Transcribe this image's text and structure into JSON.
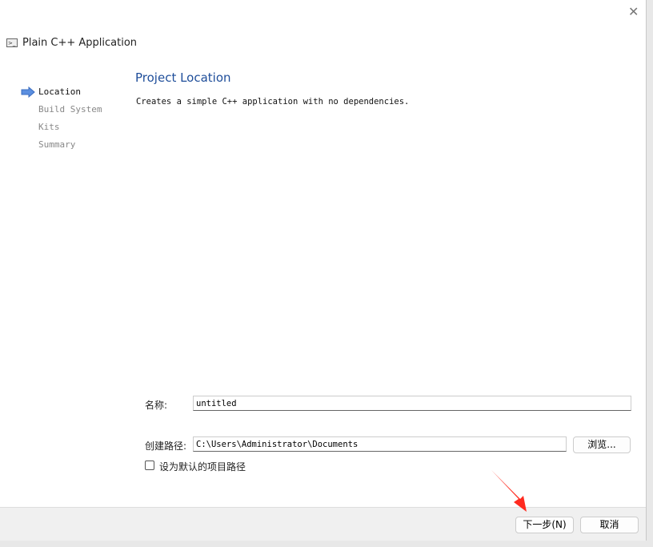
{
  "window": {
    "title": "Plain C++ Application",
    "close_icon": "close-icon"
  },
  "sidebar": {
    "items": [
      {
        "label": "Location",
        "active": true
      },
      {
        "label": "Build System"
      },
      {
        "label": "Kits"
      },
      {
        "label": "Summary"
      }
    ]
  },
  "main": {
    "heading": "Project Location",
    "description": "Creates a simple C++ application with no dependencies."
  },
  "form": {
    "name_label": "名称:",
    "name_value": "untitled",
    "path_label": "创建路径:",
    "path_value": "C:\\Users\\Administrator\\Documents",
    "browse_label": "浏览...",
    "default_checkbox_label": "设为默认的项目路径",
    "default_checked": false
  },
  "footer": {
    "next_label": "下一步(N)",
    "cancel_label": "取消"
  },
  "colors": {
    "heading": "#1f4e9a",
    "annotation_arrow": "#ff2a1f"
  }
}
